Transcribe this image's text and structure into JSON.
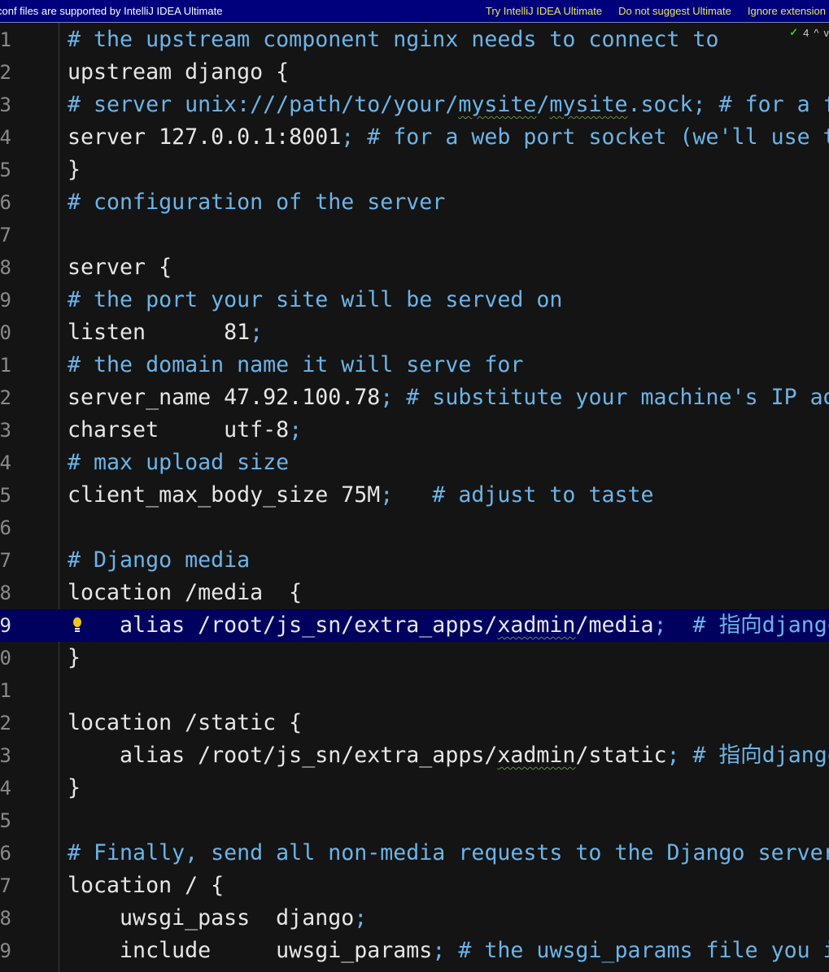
{
  "banner": {
    "message": "conf files are supported by IntelliJ IDEA Ultimate",
    "actions": [
      "Try IntelliJ IDEA Ultimate",
      "Do not suggest Ultimate",
      "Ignore extension"
    ],
    "background": "#00007c",
    "action_color": "#e6e65a"
  },
  "inspection": {
    "icon": "check-icon",
    "count": "4",
    "up": "^",
    "down": "v"
  },
  "highlighted_line": 19,
  "colors": {
    "comment": "#6cb4e8",
    "text": "#e6e6e6",
    "background": "#141414",
    "current_line": "#00005e"
  },
  "lines": [
    [
      [
        "c",
        "# the upstream component nginx needs to connect to"
      ]
    ],
    [
      [
        "t",
        "upstream django {"
      ]
    ],
    [
      [
        "c",
        "# server unix:///path/to/your/"
      ],
      [
        "cw",
        "mysite"
      ],
      [
        "c",
        "/"
      ],
      [
        "cw",
        "mysite"
      ],
      [
        "c",
        ".sock; # for a f"
      ]
    ],
    [
      [
        "t",
        "server 127.0.0.1:8001"
      ],
      [
        "c",
        "; # for a web port socket (we'll use t"
      ]
    ],
    [
      [
        "t",
        "}"
      ]
    ],
    [
      [
        "c",
        "# configuration of the server"
      ]
    ],
    [],
    [
      [
        "t",
        "server {"
      ]
    ],
    [
      [
        "c",
        "# the port your site will be served on"
      ]
    ],
    [
      [
        "t",
        "listen      81"
      ],
      [
        "c",
        ";"
      ]
    ],
    [
      [
        "c",
        "# the domain name it will serve for"
      ]
    ],
    [
      [
        "t",
        "server_name 47.92.100.78"
      ],
      [
        "c",
        "; # substitute your machine's IP ad"
      ]
    ],
    [
      [
        "t",
        "charset     utf-8"
      ],
      [
        "c",
        ";"
      ]
    ],
    [
      [
        "c",
        "# max upload size"
      ]
    ],
    [
      [
        "t",
        "client_max_body_size 75M"
      ],
      [
        "c",
        ";   # adjust to taste"
      ]
    ],
    [],
    [
      [
        "c",
        "# Django media"
      ]
    ],
    [
      [
        "t",
        "location /media  {"
      ]
    ],
    [
      [
        "t",
        "    alias /root/js_sn/extra_apps/"
      ],
      [
        "w",
        "xadmin"
      ],
      [
        "t",
        "/media"
      ],
      [
        "c",
        ";  # 指向django"
      ]
    ],
    [
      [
        "t",
        "}"
      ]
    ],
    [],
    [
      [
        "t",
        "location /static {"
      ]
    ],
    [
      [
        "t",
        "    alias /root/js_sn/extra_apps/"
      ],
      [
        "w",
        "xadmin"
      ],
      [
        "t",
        "/static"
      ],
      [
        "c",
        "; # 指向django"
      ]
    ],
    [
      [
        "t",
        "}"
      ]
    ],
    [],
    [
      [
        "c",
        "# Finally, send all non-media requests to the Django server"
      ]
    ],
    [
      [
        "t",
        "location / {"
      ]
    ],
    [
      [
        "t",
        "    uwsgi_pass  django"
      ],
      [
        "c",
        ";"
      ]
    ],
    [
      [
        "t",
        "    include     uwsgi_params"
      ],
      [
        "c",
        "; # the uwsgi_params file you i"
      ]
    ]
  ]
}
